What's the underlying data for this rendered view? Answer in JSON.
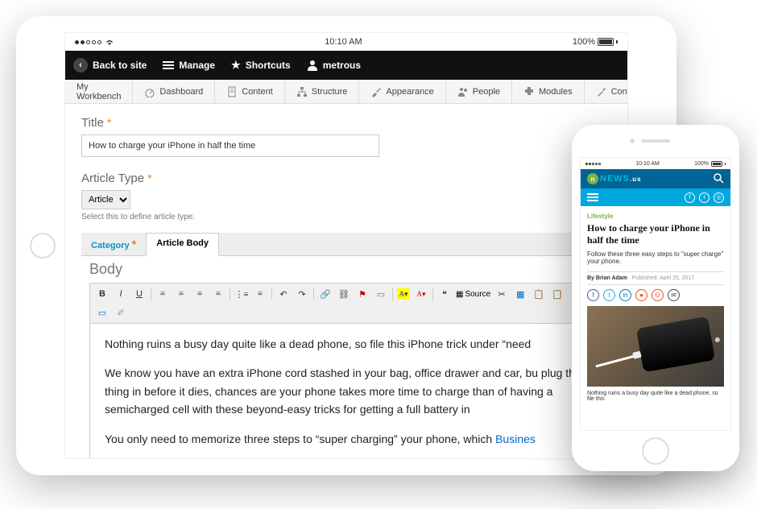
{
  "ipad_status": {
    "time": "10:10 AM",
    "battery": "100%"
  },
  "blackbar": {
    "back": "Back to site",
    "manage": "Manage",
    "shortcuts": "Shortcuts",
    "user": "metrous"
  },
  "tabs": {
    "workbench": "My Workbench",
    "dashboard": "Dashboard",
    "content": "Content",
    "structure": "Structure",
    "appearance": "Appearance",
    "people": "People",
    "modules": "Modules",
    "configuration": "Configura"
  },
  "form": {
    "title_label": "Title",
    "title_value": "How to charge your iPhone in half the time",
    "type_label": "Article Type",
    "type_value": "Article",
    "type_help": "Select this to define article type.",
    "tab_category": "Category",
    "tab_body": "Article Body",
    "body_label": "Body"
  },
  "editor": {
    "source_label": "Source",
    "p1": "Nothing ruins a busy day quite like a dead phone, so file this iPhone trick under “need",
    "p2": "We know you have an extra iPhone cord stashed in your bag, office drawer and car, bu plug the thing in before it dies, chances are your phone takes more time to charge than of having a semicharged cell with these beyond-easy tricks for getting a full battery in",
    "p3a": "You only need to memorize three steps to “super charging” your phone, which ",
    "p3_link": "Busines"
  },
  "iphone_status": {
    "time": "10:10 AM",
    "battery": "100%"
  },
  "news": {
    "logo_text": "NEWS",
    "logo_tld": ".us",
    "category": "Lifestyle",
    "headline": "How to charge your iPhone in half the time",
    "deck": "Follow these three easy steps to \"super charge\" your phone.",
    "by": "By Brian Adam",
    "published": "Published: April 25, 2017",
    "caption": "Nothing ruins a busy day quite like a dead phone, so file this"
  }
}
